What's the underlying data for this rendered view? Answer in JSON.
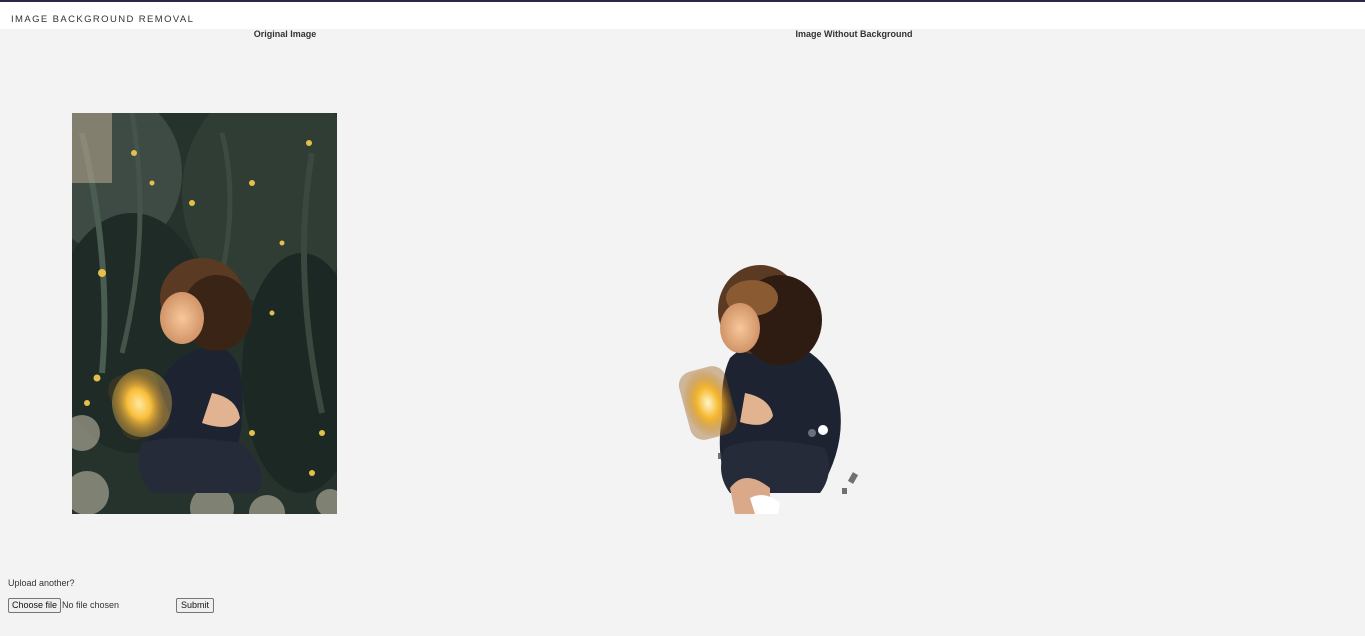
{
  "header": {
    "brand": "IMAGE BACKGROUND REMOVAL"
  },
  "columns": {
    "original_title": "Original Image",
    "result_title": "Image Without Background"
  },
  "upload": {
    "prompt": "Upload another?",
    "choose_label": "Choose file",
    "file_status": "No file chosen",
    "submit_label": "Submit"
  },
  "colors": {
    "top_rule": "#2b2850",
    "page_bg": "#f3f3f3",
    "navbar_bg": "#ffffff"
  }
}
